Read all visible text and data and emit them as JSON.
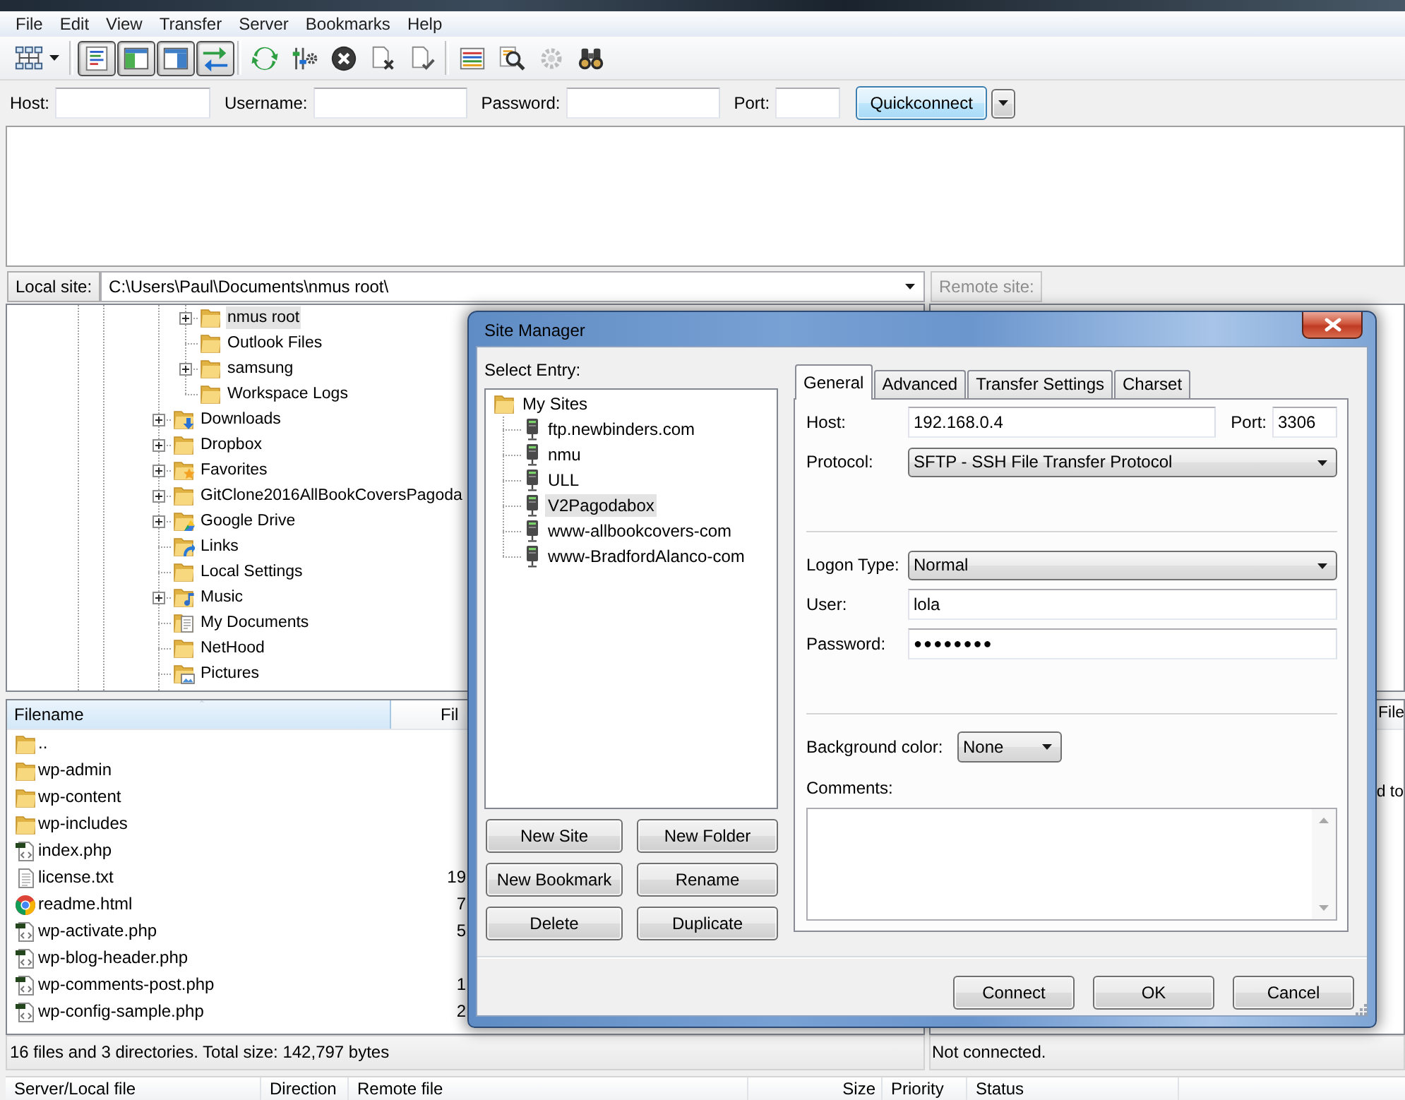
{
  "menu": [
    {
      "label": "File"
    },
    {
      "label": "Edit"
    },
    {
      "label": "View"
    },
    {
      "label": "Transfer"
    },
    {
      "label": "Server"
    },
    {
      "label": "Bookmarks"
    },
    {
      "label": "Help"
    }
  ],
  "toolbar": [
    [
      {
        "kind": "site-manager",
        "pressed": false,
        "disabled": false
      }
    ],
    [
      {
        "kind": "message-log",
        "pressed": true,
        "disabled": false
      },
      {
        "kind": "local-tree",
        "pressed": true,
        "disabled": false
      },
      {
        "kind": "remote-tree",
        "pressed": true,
        "disabled": false
      },
      {
        "kind": "transfer-queue",
        "pressed": true,
        "disabled": false
      }
    ],
    [
      {
        "kind": "refresh",
        "pressed": false,
        "disabled": false
      },
      {
        "kind": "process-queue",
        "pressed": false,
        "disabled": false
      },
      {
        "kind": "cancel",
        "pressed": false,
        "disabled": false
      },
      {
        "kind": "disconnect",
        "pressed": false,
        "disabled": false
      },
      {
        "kind": "reconnect",
        "pressed": false,
        "disabled": false
      }
    ],
    [
      {
        "kind": "filter",
        "pressed": false,
        "disabled": false
      },
      {
        "kind": "compare",
        "pressed": false,
        "disabled": false
      },
      {
        "kind": "sync-browsing",
        "pressed": false,
        "disabled": true
      },
      {
        "kind": "search",
        "pressed": false,
        "disabled": false
      }
    ]
  ],
  "quickconnect": {
    "fields": [
      {
        "label": "Host:"
      },
      {
        "label": "Username:"
      },
      {
        "label": "Password:"
      },
      {
        "label": "Port:"
      }
    ],
    "button": "Quickconnect"
  },
  "local_site": {
    "label": "Local site:",
    "path": "C:\\Users\\Paul\\Documents\\nmus root\\"
  },
  "local_tree": {
    "items": [
      {
        "children": [
          {
            "label": "nmus root",
            "kind": "folder",
            "expandable": true,
            "selected": true
          },
          {
            "label": "Outlook Files",
            "kind": "folder",
            "expandable": false,
            "selected": false
          },
          {
            "label": "samsung",
            "kind": "folder",
            "expandable": true,
            "selected": false
          },
          {
            "label": "Workspace Logs",
            "kind": "folder",
            "expandable": false,
            "selected": false
          }
        ]
      },
      {
        "label": "Downloads",
        "kind": "downloads",
        "expandable": true,
        "selected": false
      },
      {
        "label": "Dropbox",
        "kind": "folder",
        "expandable": true,
        "selected": false
      },
      {
        "label": "Favorites",
        "kind": "favorites",
        "expandable": true,
        "selected": false
      },
      {
        "label": "GitClone2016AllBookCoversPagoda",
        "kind": "folder",
        "expandable": true,
        "selected": false
      },
      {
        "label": "Google Drive",
        "kind": "drive",
        "expandable": true,
        "selected": false
      },
      {
        "label": "Links",
        "kind": "links",
        "expandable": false,
        "selected": false
      },
      {
        "label": "Local Settings",
        "kind": "folder",
        "expandable": false,
        "selected": false
      },
      {
        "label": "Music",
        "kind": "music",
        "expandable": true,
        "selected": false
      },
      {
        "label": "My Documents",
        "kind": "documents",
        "expandable": false,
        "selected": false
      },
      {
        "label": "NetHood",
        "kind": "folder",
        "expandable": false,
        "selected": false
      },
      {
        "label": "Pictures",
        "kind": "pictures",
        "expandable": false,
        "selected": false
      }
    ]
  },
  "local_files": {
    "columns": [
      {
        "label": "Filename",
        "sorted": true
      },
      {
        "label": "Fil",
        "sorted": false
      }
    ],
    "rows": [
      {
        "kind": "folder",
        "name": ".."
      },
      {
        "kind": "folder",
        "name": "wp-admin"
      },
      {
        "kind": "folder",
        "name": "wp-content"
      },
      {
        "kind": "folder",
        "name": "wp-includes"
      },
      {
        "kind": "php",
        "name": "index.php"
      },
      {
        "kind": "text",
        "name": "license.txt",
        "size": "19"
      },
      {
        "kind": "html",
        "name": "readme.html",
        "size": "7"
      },
      {
        "kind": "php",
        "name": "wp-activate.php",
        "size": "5"
      },
      {
        "kind": "php",
        "name": "wp-blog-header.php"
      },
      {
        "kind": "php",
        "name": "wp-comments-post.php",
        "size": "1"
      },
      {
        "kind": "php",
        "name": "wp-config-sample.php",
        "size": "2"
      }
    ]
  },
  "local_status": "16 files and 3 directories. Total size: 142,797 bytes",
  "remote_site": {
    "label": "Remote site:",
    "disabled": true
  },
  "remote_files": {
    "columns": [
      {
        "label": "File"
      }
    ],
    "message": "d to"
  },
  "remote_status": "Not connected.",
  "queue": {
    "columns": [
      "Server/Local file",
      "Direction",
      "Remote file",
      "Size",
      "Priority",
      "Status"
    ]
  },
  "site_manager": {
    "title": "Site Manager",
    "select_label": "Select Entry:",
    "tree": [
      {
        "label": "My Sites",
        "kind": "folder",
        "selected": false,
        "children": [
          {
            "label": "ftp.newbinders.com",
            "kind": "site",
            "selected": false
          },
          {
            "label": "nmu",
            "kind": "site",
            "selected": false
          },
          {
            "label": "ULL",
            "kind": "site",
            "selected": false
          },
          {
            "label": "V2Pagodabox",
            "kind": "site",
            "selected": true
          },
          {
            "label": "www-allbookcovers-com",
            "kind": "site",
            "selected": false
          },
          {
            "label": "www-BradfordAlanco-com",
            "kind": "site",
            "selected": false
          }
        ]
      }
    ],
    "buttons": [
      "New Site",
      "New Folder",
      "New Bookmark",
      "Rename",
      "Delete",
      "Duplicate"
    ],
    "tabs": [
      {
        "label": "General",
        "selected": true
      },
      {
        "label": "Advanced",
        "selected": false
      },
      {
        "label": "Transfer Settings",
        "selected": false
      },
      {
        "label": "Charset",
        "selected": false
      }
    ],
    "general": {
      "host": {
        "label": "Host:",
        "value": "192.168.0.4"
      },
      "port": {
        "label": "Port:",
        "value": "3306"
      },
      "protocol": {
        "label": "Protocol:",
        "value": "SFTP - SSH File Transfer Protocol"
      },
      "logon_type": {
        "label": "Logon Type:",
        "value": "Normal"
      },
      "user": {
        "label": "User:",
        "value": "lola"
      },
      "password": {
        "label": "Password:",
        "value": "●●●●●●●●"
      },
      "background_color": {
        "label": "Background color:",
        "value": "None"
      },
      "comments": {
        "label": "Comments:"
      }
    },
    "footer_buttons": [
      "Connect",
      "OK",
      "Cancel"
    ]
  }
}
